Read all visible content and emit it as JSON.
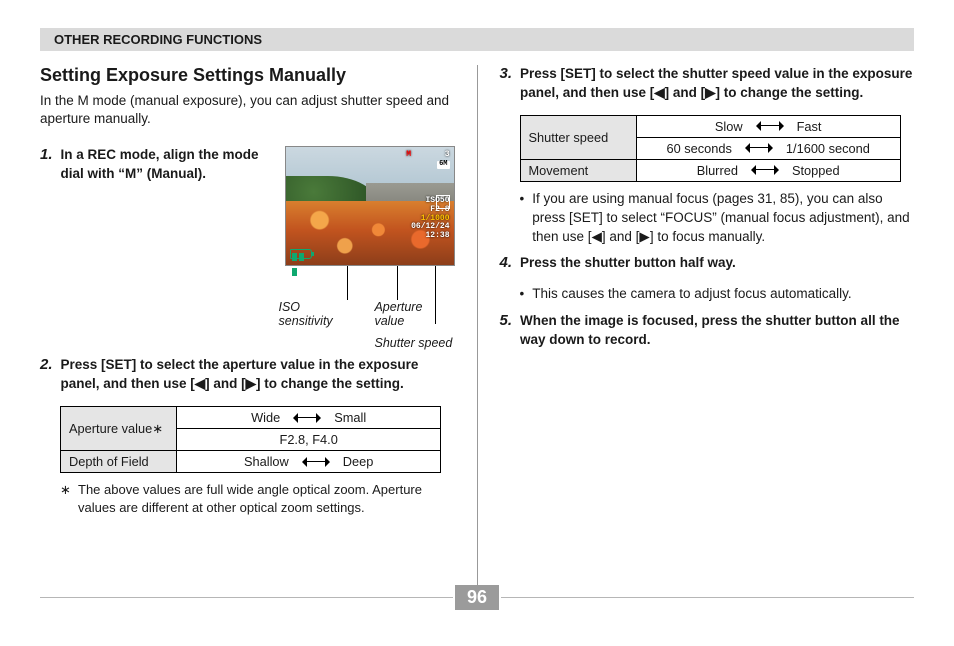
{
  "section_header": "OTHER RECORDING FUNCTIONS",
  "title": "Setting Exposure Settings Manually",
  "intro": "In the M mode (manual exposure), you can adjust shutter speed and aperture manually.",
  "steps": {
    "s1": {
      "num": "1.",
      "text": "In a REC mode, align the mode dial with “M” (Manual)."
    },
    "s2": {
      "num": "2.",
      "text": "Press [SET] to select the aperture value in the exposure panel, and then use [◀] and [▶] to change the setting."
    },
    "s3": {
      "num": "3.",
      "text": "Press [SET] to select the shutter speed value in the exposure panel, and then use [◀] and [▶] to change the setting."
    },
    "s4": {
      "num": "4.",
      "text": "Press the shutter button half way."
    },
    "s5": {
      "num": "5.",
      "text": "When the image is focused, press the shutter button all the way down to record."
    }
  },
  "callouts": {
    "iso": "ISO sensitivity",
    "apv": "Aperture value",
    "ss": "Shutter speed"
  },
  "osd": {
    "mode": "M",
    "count": "3",
    "size": "6M",
    "iso": "ISO50",
    "fval": "F2.8",
    "ss": "1/1000",
    "date": "06/12/24",
    "time": "12:38"
  },
  "aperture_table": {
    "r1_hdr": "Aperture value∗",
    "r1_l": "Wide",
    "r1_r": "Small",
    "r1_line2": "F2.8, F4.0",
    "r2_hdr": "Depth of Field",
    "r2_l": "Shallow",
    "r2_r": "Deep"
  },
  "aperture_footnote": {
    "sym": "∗",
    "text": "The above values are full wide angle optical zoom. Aperture values are different at other optical zoom settings."
  },
  "shutter_table": {
    "r1_hdr": "Shutter speed",
    "r1a_l": "Slow",
    "r1a_r": "Fast",
    "r1b_l": "60 seconds",
    "r1b_r": "1/1600 second",
    "r2_hdr": "Movement",
    "r2_l": "Blurred",
    "r2_r": "Stopped"
  },
  "shutter_bullet": "If you are using manual focus (pages 31, 85), you can also press [SET] to select “FOCUS” (manual focus adjustment), and then use [◀] and [▶] to focus manually.",
  "step4_bullet": "This causes the camera to adjust focus automatically.",
  "page_number": "96"
}
